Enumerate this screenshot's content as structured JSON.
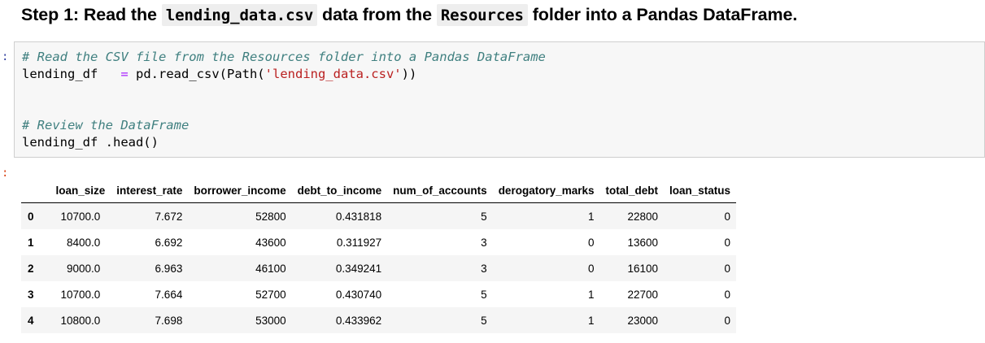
{
  "markdown": {
    "step_prefix": "Step 1: Read the ",
    "file_code": "lending_data.csv",
    "middle": " data from the ",
    "folder_code": "Resources",
    "suffix": " folder into a Pandas DataFrame."
  },
  "prompts": {
    "input": ":",
    "output": ":"
  },
  "code": {
    "line1_comment": "# Read the CSV file from the Resources folder into a Pandas DataFrame",
    "line2_var": "lending_df   ",
    "line2_op": "=",
    "line2_call": " pd.read_csv(Path(",
    "line2_str": "'lending_data.csv'",
    "line2_end": "))",
    "line5_comment": "# Review the DataFrame",
    "line6": "lending_df .head()"
  },
  "table": {
    "columns": [
      "loan_size",
      "interest_rate",
      "borrower_income",
      "debt_to_income",
      "num_of_accounts",
      "derogatory_marks",
      "total_debt",
      "loan_status"
    ],
    "rows": [
      {
        "index": "0",
        "cells": [
          "10700.0",
          "7.672",
          "52800",
          "0.431818",
          "5",
          "1",
          "22800",
          "0"
        ]
      },
      {
        "index": "1",
        "cells": [
          "8400.0",
          "6.692",
          "43600",
          "0.311927",
          "3",
          "0",
          "13600",
          "0"
        ]
      },
      {
        "index": "2",
        "cells": [
          "9000.0",
          "6.963",
          "46100",
          "0.349241",
          "3",
          "0",
          "16100",
          "0"
        ]
      },
      {
        "index": "3",
        "cells": [
          "10700.0",
          "7.664",
          "52700",
          "0.430740",
          "5",
          "1",
          "22700",
          "0"
        ]
      },
      {
        "index": "4",
        "cells": [
          "10800.0",
          "7.698",
          "53000",
          "0.433962",
          "5",
          "1",
          "23000",
          "0"
        ]
      }
    ]
  }
}
